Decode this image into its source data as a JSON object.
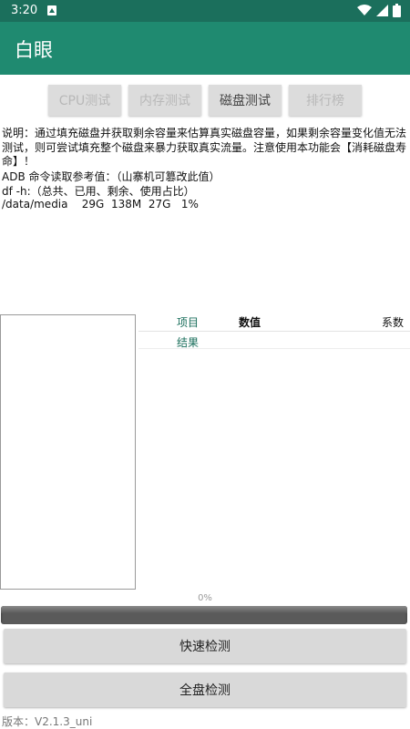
{
  "status_bar": {
    "time": "3:20"
  },
  "app": {
    "title": "白眼",
    "accent_color": "#1f8a70",
    "status_color": "#1b6f5c"
  },
  "tabs": [
    {
      "label": "CPU测试",
      "active": false
    },
    {
      "label": "内存测试",
      "active": false
    },
    {
      "label": "磁盘测试",
      "active": true
    },
    {
      "label": "排行榜",
      "active": false
    }
  ],
  "description": "说明：通过填充磁盘并获取剩余容量来估算真实磁盘容量，如果剩余容量变化值无法测试，则可尝试填充整个磁盘来暴力获取真实流量。注意使用本功能会【消耗磁盘寿命】！",
  "adb": {
    "title": "ADB 命令读取参考值：（山寨机可篡改此值）",
    "cmd": "df -h:（总共、已用、剩余、使用占比）",
    "row": "/data/media    29G  138M  27G   1%"
  },
  "table": {
    "col_item": "项目",
    "col_value": "数值",
    "col_factor": "系数",
    "row_result": "结果"
  },
  "progress": {
    "label": "0%",
    "value": 0
  },
  "buttons": {
    "quick": "快速检测",
    "full": "全盘检测"
  },
  "version": "版本：V2.1.3_uni"
}
